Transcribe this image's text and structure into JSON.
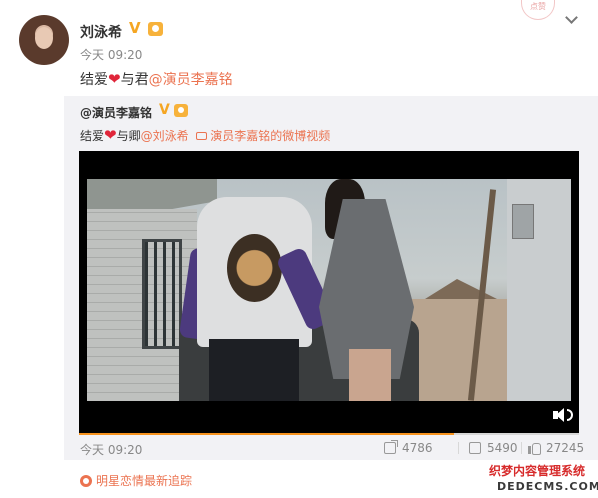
{
  "post": {
    "author": "刘泳希",
    "verified_mark": "V",
    "time": "今天 09:20",
    "text_prefix": "结爱",
    "heart": "❤",
    "text_mid": "与君",
    "mention": "@演员李嘉铭",
    "stamp_text": "点赞"
  },
  "repost": {
    "author": "@演员李嘉铭",
    "verified_mark": "V",
    "text_prefix": "结爱",
    "heart": "❤",
    "text_mid": "与卿",
    "mention": "@刘泳希",
    "video_link": "演员李嘉铭的微博视频",
    "time": "今天 09:20",
    "progress_fraction": 0.75
  },
  "stats": {
    "reposts": "4786",
    "comments": "5490",
    "likes": "27245"
  },
  "topic": {
    "label": "明星恋情最新追踪"
  },
  "watermark": {
    "line1": "织梦内容管理系统",
    "line2": "DEDECMS.COM"
  },
  "colors": {
    "accent": "#eb7350",
    "heart": "#e0263a",
    "verified": "#f5a623",
    "progress": "#f7931e"
  },
  "icons": [
    "more-chevron-icon",
    "verified-icon",
    "medal-icon",
    "video-link-icon",
    "mute-icon",
    "repost-icon",
    "comment-icon",
    "like-icon",
    "topic-icon"
  ]
}
